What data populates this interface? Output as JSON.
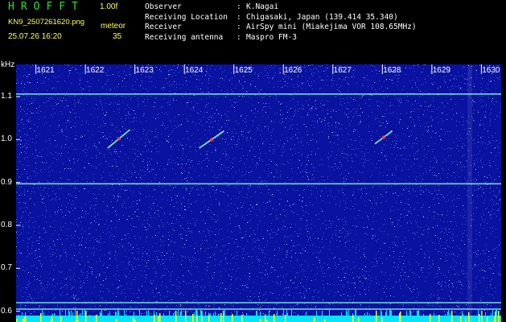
{
  "header": {
    "app_title": "HROFFT",
    "version": "1.00f",
    "filename": "KN9_2507261620.png",
    "meteor_label": "meteor",
    "datetime": "25.07.26 16:20",
    "meteor_count": "35"
  },
  "info": [
    {
      "key": "Observer",
      "value": "K.Nagai"
    },
    {
      "key": "Receiving Location",
      "value": "Chigasaki, Japan (139.414 35.340)"
    },
    {
      "key": "Receiver",
      "value": "AirSpy mini (Miakejima VOR 108.65MHz)"
    },
    {
      "key": "Receiving antenna",
      "value": "Maspro FM-3"
    }
  ],
  "chart_data": {
    "type": "heatmap",
    "ylabel": "kHz",
    "y_ticks": [
      "1.1",
      "1.0",
      "0.9",
      "0.8",
      "0.7",
      "0.6"
    ],
    "y_tick_values": [
      1.1,
      1.0,
      0.9,
      0.8,
      0.7,
      0.6
    ],
    "x_ticks": [
      "1621",
      "1622",
      "1623",
      "1624",
      "1625",
      "1626",
      "1627",
      "1628",
      "1629",
      "1630"
    ],
    "x_tick_values": [
      1621,
      1622,
      1623,
      1624,
      1625,
      1626,
      1627,
      1628,
      1629,
      1630
    ],
    "xlim": [
      1620.6,
      1630.4
    ],
    "ylim": [
      0.575,
      1.175
    ],
    "horizontal_lines": [
      1.106,
      0.897,
      0.62,
      0.605
    ],
    "meteor_traces": [
      {
        "x_start": 1622.45,
        "x_end": 1622.9,
        "y_start": 0.98,
        "y_end": 1.023
      },
      {
        "x_start": 1624.3,
        "x_end": 1624.8,
        "y_start": 0.98,
        "y_end": 1.02
      },
      {
        "x_start": 1627.85,
        "x_end": 1628.2,
        "y_start": 0.99,
        "y_end": 1.02
      }
    ],
    "colors": {
      "background": "#0a12a0",
      "noise": "#6fa0ff",
      "line": "#7fffd4",
      "trace": "#ff4040",
      "baseline": "#00e5ff",
      "spike": "#ffff00"
    }
  }
}
